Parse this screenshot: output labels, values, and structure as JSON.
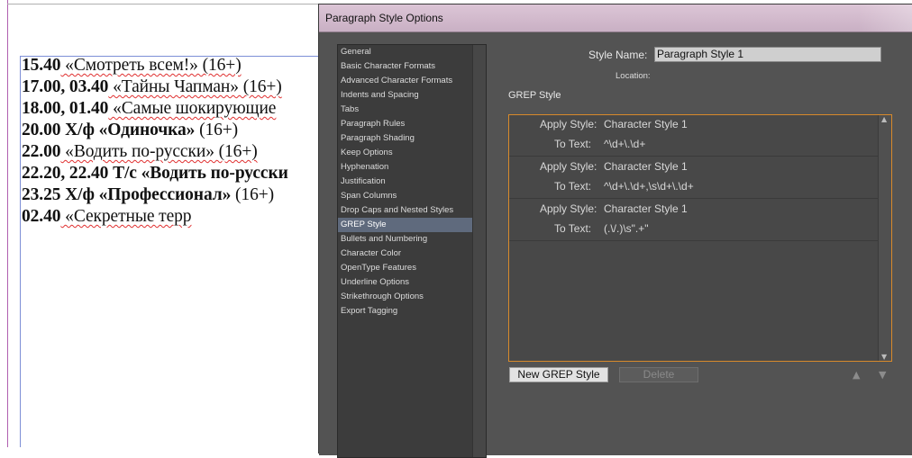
{
  "document": {
    "lines": [
      {
        "bold": "15.40",
        "text": " «Смотреть всем!» (16+)"
      },
      {
        "bold": "17.00, 03.40",
        "text": " «Тайны Чапман» (16+)"
      },
      {
        "bold": "18.00, 01.40",
        "text": " «Самые шокирующие"
      },
      {
        "bold": "20.00 Х/ф «Одиночка»",
        "text": " (16+)"
      },
      {
        "bold": "22.00",
        "text": " «Водить по-русски» (16+)"
      },
      {
        "bold": "22.20, 22.40 Т/с «Водить по-русски",
        "text": ""
      },
      {
        "bold": "23.25 Х/ф «Профессионал»",
        "text": " (16+)"
      },
      {
        "bold": "02.40",
        "text": " «Секретные терр"
      }
    ]
  },
  "dialog": {
    "title": "Paragraph Style Options",
    "categories": [
      "General",
      "Basic Character Formats",
      "Advanced Character Formats",
      "Indents and Spacing",
      "Tabs",
      "Paragraph Rules",
      "Paragraph Shading",
      "Keep Options",
      "Hyphenation",
      "Justification",
      "Span Columns",
      "Drop Caps and Nested Styles",
      "GREP Style",
      "Bullets and Numbering",
      "Character Color",
      "OpenType Features",
      "Underline Options",
      "Strikethrough Options",
      "Export Tagging"
    ],
    "selected_category": "GREP Style",
    "style_name_label": "Style Name:",
    "style_name_value": "Paragraph Style 1",
    "location_label": "Location:",
    "section_title": "GREP Style",
    "rules": [
      {
        "apply_label": "Apply Style:",
        "style": "Character Style 1",
        "to_label": "To Text:",
        "pattern": "^\\d+\\.\\d+"
      },
      {
        "apply_label": "Apply Style:",
        "style": "Character Style 1",
        "to_label": "To Text:",
        "pattern": "^\\d+\\.\\d+,\\s\\d+\\.\\d+"
      },
      {
        "apply_label": "Apply Style:",
        "style": "Character Style 1",
        "to_label": "To Text:",
        "pattern": "(.\\/.)\\s\".+\""
      }
    ],
    "new_button": "New GREP Style",
    "delete_button": "Delete",
    "move_up_icon": "▲",
    "move_down_icon": "▼",
    "accent_color": "#d88a2b"
  }
}
